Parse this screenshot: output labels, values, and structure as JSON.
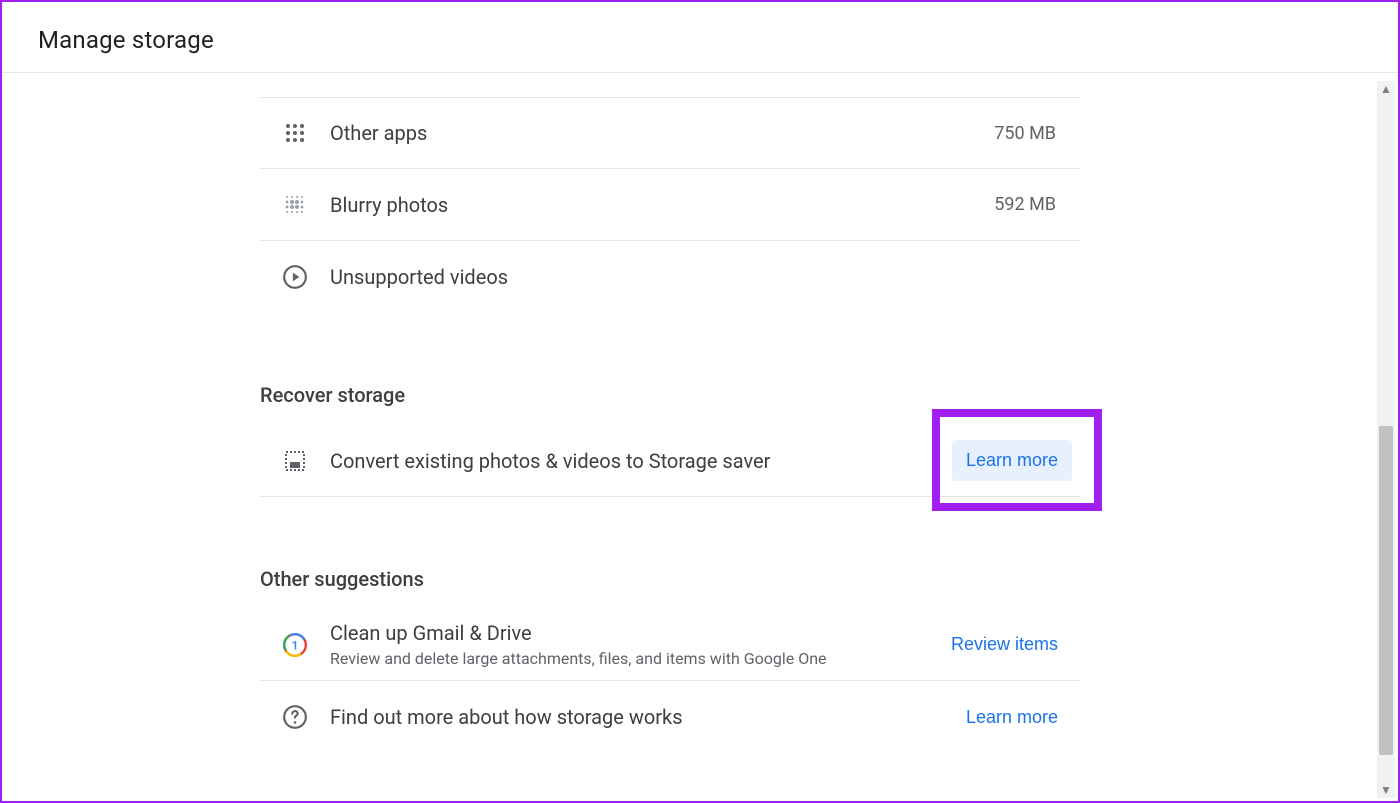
{
  "header": {
    "title": "Manage storage"
  },
  "storage_items": [
    {
      "label": "Other apps",
      "size": "750 MB"
    },
    {
      "label": "Blurry photos",
      "size": "592 MB"
    },
    {
      "label": "Unsupported videos",
      "size": ""
    }
  ],
  "recover": {
    "section_title": "Recover storage",
    "convert_label": "Convert existing photos & videos to Storage saver",
    "learn_more": "Learn more"
  },
  "suggestions": {
    "section_title": "Other suggestions",
    "cleanup_title": "Clean up Gmail & Drive",
    "cleanup_sub": "Review and delete large attachments, files, and items with Google One",
    "cleanup_action": "Review items",
    "howworks_title": "Find out more about how storage works",
    "howworks_action": "Learn more"
  }
}
